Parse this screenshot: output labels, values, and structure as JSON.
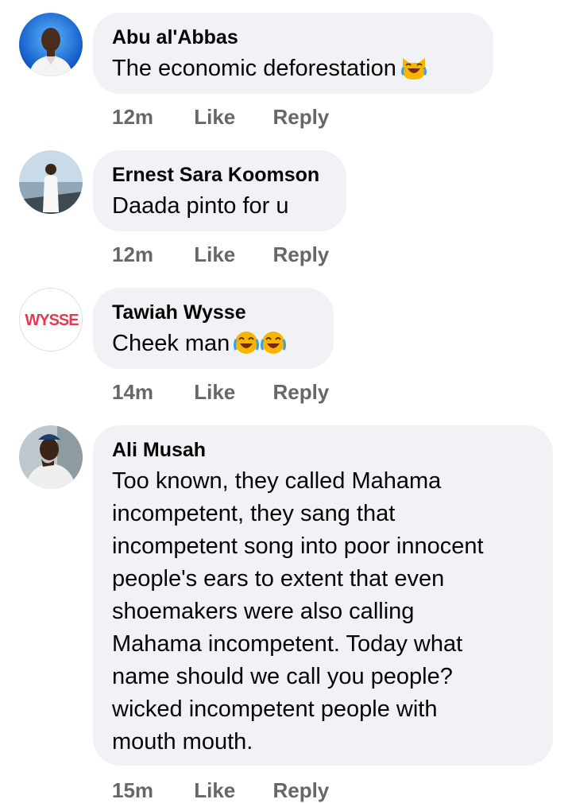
{
  "comments": [
    {
      "author": "Abu al'Abbas",
      "text": "The economic deforestation",
      "emojis": [
        "laughing-cat"
      ],
      "time": "12m",
      "like_label": "Like",
      "reply_label": "Reply"
    },
    {
      "author": "Ernest Sara Koomson",
      "text": "Daada pinto for u",
      "emojis": [],
      "time": "12m",
      "like_label": "Like",
      "reply_label": "Reply"
    },
    {
      "author": "Tawiah Wysse",
      "text": "Cheek man",
      "emojis": [
        "tears-of-joy",
        "tears-of-joy"
      ],
      "time": "14m",
      "like_label": "Like",
      "reply_label": "Reply",
      "avatar_text": "WYSSE"
    },
    {
      "author": "Ali Musah",
      "text": "Too known, they called Mahama\nincompetent, they sang that\nincompetent song into poor innocent\npeople's ears to extent that even\nshoemakers were also calling\nMahama incompetent. Today what\nname should we call you people?\nwicked incompetent people with\nmouth mouth.",
      "emojis": [],
      "time": "15m",
      "like_label": "Like",
      "reply_label": "Reply"
    }
  ],
  "colors": {
    "bubble": "#f0f2f5",
    "meta_text": "#65676b",
    "emoji_yellow": "#f7b500",
    "emoji_tear": "#3aa0e8"
  }
}
